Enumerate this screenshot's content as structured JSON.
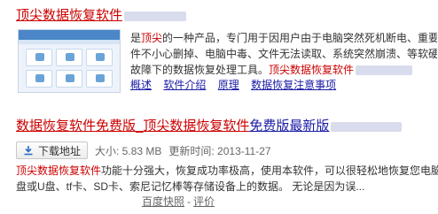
{
  "result1": {
    "title_red": "顶尖数据恢复软件",
    "desc_line1_lead": "是",
    "desc_line1_red": "顶尖",
    "desc_line1_rest": "的一种产品，专门用于因用户由于电脑突然死机断电、重要文",
    "desc_line2": "件不小心删掉、电脑中毒、文件无法读取、系统突然崩溃、等软硬件",
    "desc_line3_lead": "故障下的数据恢复处理工具。",
    "desc_line3_red": "顶尖数据恢复软件",
    "links": [
      "概述",
      "软件介绍",
      "原理",
      "数据恢复注意事项"
    ]
  },
  "result2": {
    "title_part1": "数据恢复软件免费版_顶尖数据恢复软件",
    "title_part2": "免费版最新版",
    "download_label": "下载地址",
    "size_text": "大小: 5.83 MB",
    "update_text": "更新时间: 2013-11-27",
    "desc_line1_red": "顶尖数据恢复软件",
    "desc_line1_rest": "功能十分强大，恢复成功率极高，使用本软件，可以很轻松地恢复您电脑硬",
    "desc_line2": "盘或U盘、tf卡、SD卡、索尼记忆棒等存储设备上的数据。 无论是因为误...",
    "snapshot": "百度快照",
    "sep": "-",
    "review": "评价"
  },
  "colors": {
    "title_red": "#cc0000",
    "link_blue": "#1a1aa6",
    "text": "#333333"
  }
}
